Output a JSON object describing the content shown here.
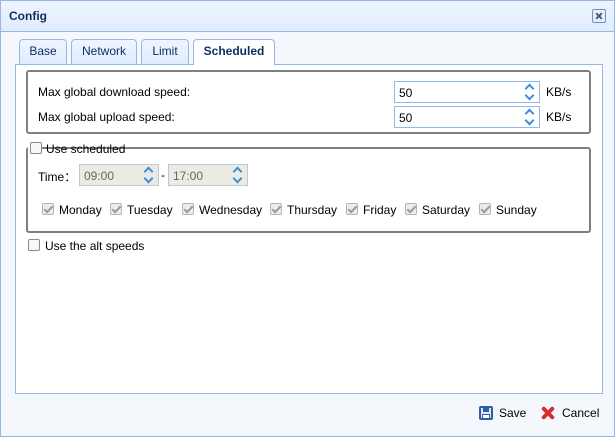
{
  "window": {
    "title": "Config"
  },
  "tabs": [
    {
      "label": "Base",
      "selected": false
    },
    {
      "label": "Network",
      "selected": false
    },
    {
      "label": "Limit",
      "selected": false
    },
    {
      "label": "Scheduled",
      "selected": true
    }
  ],
  "speeds": {
    "download_label": "Max global download speed:",
    "download_value": "50",
    "upload_label": "Max global upload speed:",
    "upload_value": "50",
    "unit": "KB/s"
  },
  "scheduled": {
    "use_label": "Use scheduled",
    "use_checked": false,
    "time_label": "Time：",
    "time_start": "09:00",
    "time_separator": "-",
    "time_end": "17:00",
    "days": [
      {
        "label": "Monday",
        "checked": true
      },
      {
        "label": "Tuesday",
        "checked": true
      },
      {
        "label": "Wednesday",
        "checked": true
      },
      {
        "label": "Thursday",
        "checked": true
      },
      {
        "label": "Friday",
        "checked": true
      },
      {
        "label": "Saturday",
        "checked": true
      },
      {
        "label": "Sunday",
        "checked": true
      }
    ]
  },
  "alt_speeds": {
    "label": "Use the alt speeds",
    "checked": false
  },
  "footer": {
    "save_label": "Save",
    "cancel_label": "Cancel"
  },
  "icons": {
    "close": "close-icon",
    "save": "save-icon",
    "cancel": "cancel-icon"
  }
}
